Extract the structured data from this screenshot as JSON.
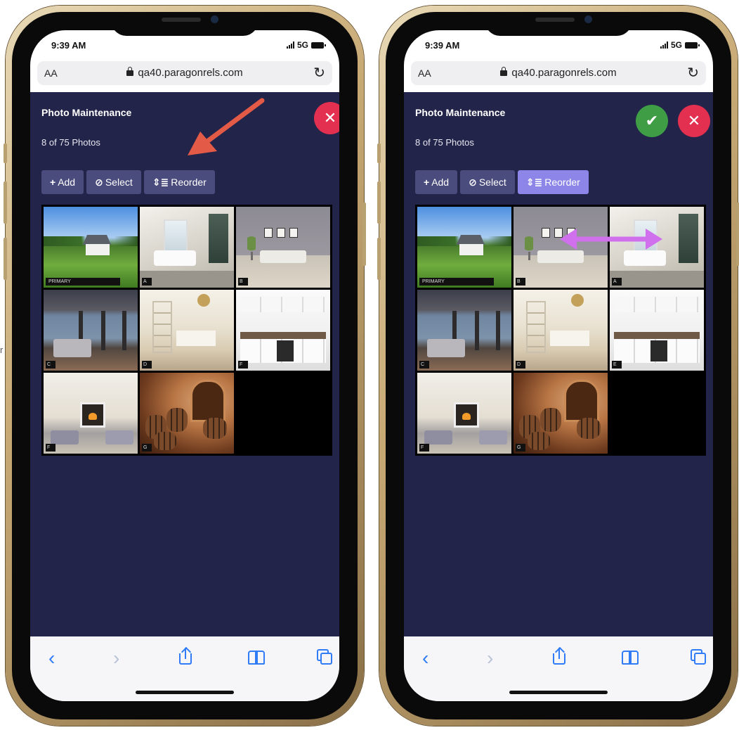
{
  "stray_text": "r",
  "status_bar": {
    "time": "9:39 AM",
    "network": "5G"
  },
  "browser": {
    "text_size_label": "AA",
    "host": "qa40.paragonrels.com"
  },
  "colors": {
    "app_bg": "#23244a",
    "button_bg": "#4a4c7e",
    "button_active": "#8d86e8",
    "cancel": "#e43050",
    "confirm": "#3f9e45",
    "annotation_arrow": "#e35a46",
    "annotation_swap": "#d070ec"
  },
  "screens": [
    {
      "title": "Photo Maintenance",
      "count": "8 of 75 Photos",
      "buttons": {
        "add": "Add",
        "select": "Select",
        "reorder": "Reorder"
      },
      "reorder_active": false,
      "photos": [
        {
          "label": "PRIMARY",
          "art": "house"
        },
        {
          "label": "A",
          "art": "bath"
        },
        {
          "label": "B",
          "art": "living"
        },
        {
          "label": "C",
          "art": "bedroom"
        },
        {
          "label": "D",
          "art": "kitchen1"
        },
        {
          "label": "F",
          "art": "kitchen2"
        },
        {
          "label": "F",
          "art": "family"
        },
        {
          "label": "G",
          "art": "cellar"
        }
      ]
    },
    {
      "title": "Photo Maintenance",
      "count": "8 of 75 Photos",
      "buttons": {
        "add": "Add",
        "select": "Select",
        "reorder": "Reorder"
      },
      "reorder_active": true,
      "photos": [
        {
          "label": "PRIMARY",
          "art": "house"
        },
        {
          "label": "B",
          "art": "living"
        },
        {
          "label": "A",
          "art": "bath"
        },
        {
          "label": "C",
          "art": "bedroom"
        },
        {
          "label": "D",
          "art": "kitchen1"
        },
        {
          "label": "E",
          "art": "kitchen2"
        },
        {
          "label": "F",
          "art": "family"
        },
        {
          "label": "G",
          "art": "cellar"
        }
      ]
    }
  ]
}
